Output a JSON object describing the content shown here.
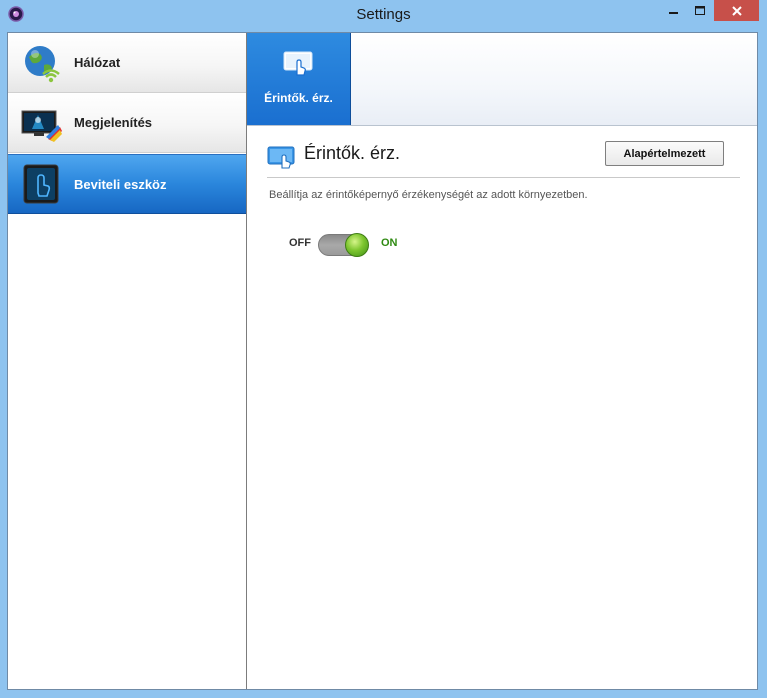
{
  "window": {
    "title": "Settings"
  },
  "sidebar": {
    "items": [
      {
        "label": "Hálózat",
        "icon": "globe-wifi-icon",
        "active": false
      },
      {
        "label": "Megjelenítés",
        "icon": "display-icon",
        "active": false
      },
      {
        "label": "Beviteli eszköz",
        "icon": "touch-hand-icon",
        "active": true
      }
    ]
  },
  "tabs": [
    {
      "label": "Érintők. érz.",
      "icon": "touch-screen-icon",
      "active": true
    }
  ],
  "section": {
    "title": "Érintők. érz.",
    "default_button": "Alapértelmezett",
    "description": "Beállítja az érintőképernyő érzékenységét az adott környezetben.",
    "toggle": {
      "off_label": "OFF",
      "on_label": "ON",
      "state": "on"
    }
  },
  "colors": {
    "accent_blue": "#1a6fd0",
    "toggle_green": "#7ec62f",
    "close_red": "#c7504a",
    "frame_blue": "#8ec3ef"
  }
}
